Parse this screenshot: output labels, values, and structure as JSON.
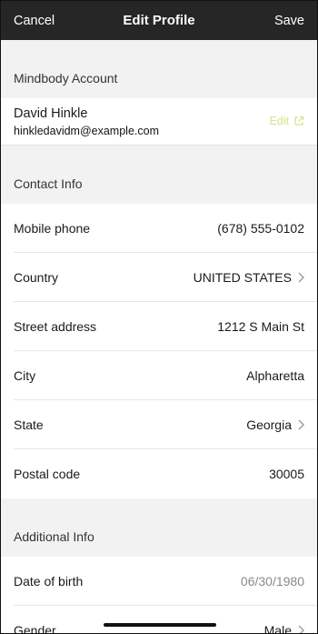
{
  "header": {
    "cancel": "Cancel",
    "title": "Edit Profile",
    "save": "Save"
  },
  "account": {
    "section_title": "Mindbody Account",
    "name": "David Hinkle",
    "email": "hinkledavidm@example.com",
    "edit_label": "Edit",
    "edit_icon": "external-link-icon",
    "edit_color": "#d9e08c"
  },
  "contact": {
    "section_title": "Contact Info",
    "rows": [
      {
        "label": "Mobile phone",
        "value": "(678) 555-0102",
        "chevron": false
      },
      {
        "label": "Country",
        "value": "UNITED STATES",
        "chevron": true
      },
      {
        "label": "Street address",
        "value": "1212 S Main St",
        "chevron": false
      },
      {
        "label": "City",
        "value": "Alpharetta",
        "chevron": false
      },
      {
        "label": "State",
        "value": "Georgia",
        "chevron": true
      },
      {
        "label": "Postal code",
        "value": "30005",
        "chevron": false
      }
    ]
  },
  "additional": {
    "section_title": "Additional Info",
    "rows": [
      {
        "label": "Date of birth",
        "value": "06/30/1980",
        "chevron": false
      },
      {
        "label": "Gender",
        "value": "Male",
        "chevron": true
      }
    ]
  }
}
